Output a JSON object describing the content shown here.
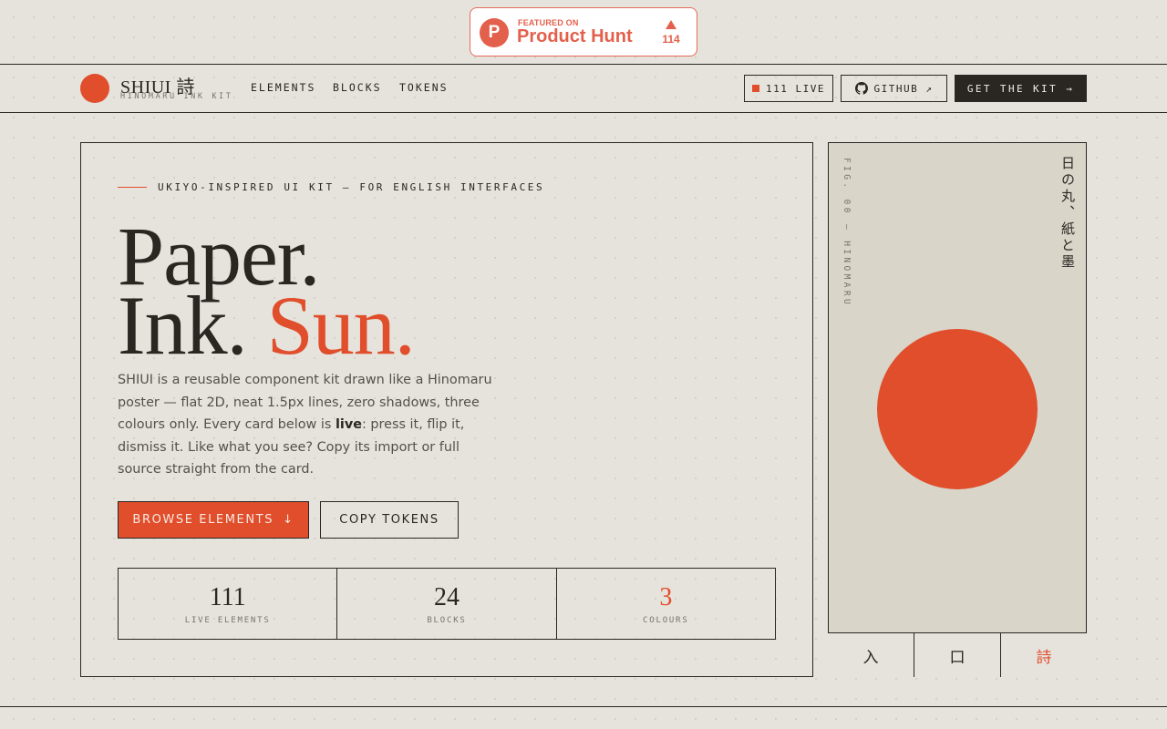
{
  "product_hunt": {
    "featured": "FEATURED ON",
    "name": "Product Hunt",
    "logo_letter": "P",
    "upvotes": "114"
  },
  "header": {
    "brand_name": "SHIUI 詩",
    "brand_sub": "HINOMARU INK KIT",
    "nav": [
      "ELEMENTS",
      "BLOCKS",
      "TOKENS"
    ],
    "live_label": "111 LIVE",
    "github_label": "GITHUB ↗",
    "kit_label": "GET THE KIT →"
  },
  "hero": {
    "eyebrow": "UKIYO-INSPIRED UI KIT — FOR ENGLISH INTERFACES",
    "headline_line1": "Paper.",
    "headline_line2_a": "Ink.",
    "headline_line2_b": "Sun.",
    "desc_a": "SHIUI is a reusable component kit drawn like a Hinomaru poster — flat 2D, neat 1.5px lines, zero shadows, three colours only. Every card below is ",
    "desc_bold": "live",
    "desc_b": ": press it, flip it, dismiss it. Like what you see? Copy its import or full source straight from the card.",
    "cta_primary": "BROWSE ELEMENTS",
    "cta_primary_arrow": "↓",
    "cta_secondary": "COPY TOKENS",
    "stats": [
      {
        "value": "111",
        "label": "LIVE ELEMENTS"
      },
      {
        "value": "24",
        "label": "BLOCKS"
      },
      {
        "value": "3",
        "label": "COLOURS"
      }
    ]
  },
  "poster": {
    "fig_caption": "FIG. 00 — HINOMARU",
    "jp_text": "日の丸、紙と墨",
    "tabs": [
      "入",
      "口",
      "詩"
    ]
  },
  "colors": {
    "paper": "#e6e2dc",
    "ink": "#2a2723",
    "sun": "#e04e2c",
    "poster_bg": "#d9d5c9",
    "product_hunt": "#e3604c"
  }
}
